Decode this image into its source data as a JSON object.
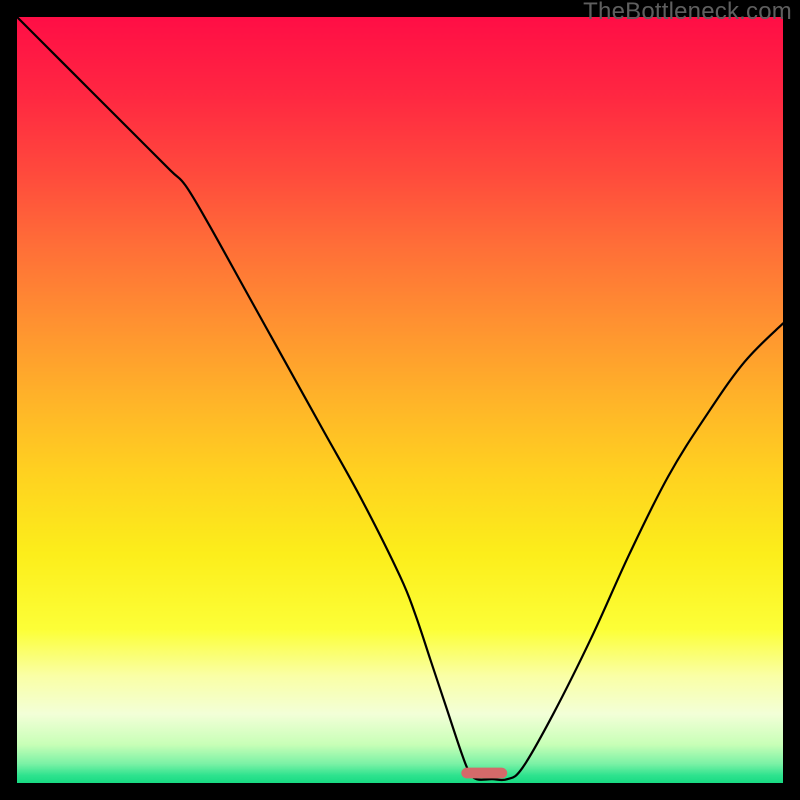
{
  "watermark": "TheBottleneck.com",
  "chart_data": {
    "type": "line",
    "title": "",
    "xlabel": "",
    "ylabel": "",
    "xlim": [
      0,
      100
    ],
    "ylim": [
      0,
      100
    ],
    "grid": false,
    "legend": false,
    "background_gradient": {
      "stops": [
        {
          "pos": 0.0,
          "color": "#ff0e46"
        },
        {
          "pos": 0.1,
          "color": "#ff2742"
        },
        {
          "pos": 0.2,
          "color": "#ff493d"
        },
        {
          "pos": 0.3,
          "color": "#ff6f38"
        },
        {
          "pos": 0.4,
          "color": "#ff9231"
        },
        {
          "pos": 0.5,
          "color": "#ffb429"
        },
        {
          "pos": 0.6,
          "color": "#ffd320"
        },
        {
          "pos": 0.7,
          "color": "#fcee1b"
        },
        {
          "pos": 0.8,
          "color": "#fcff38"
        },
        {
          "pos": 0.86,
          "color": "#faffa6"
        },
        {
          "pos": 0.91,
          "color": "#f3ffd8"
        },
        {
          "pos": 0.95,
          "color": "#c8ffb7"
        },
        {
          "pos": 0.975,
          "color": "#7bf2a6"
        },
        {
          "pos": 0.99,
          "color": "#2fe38f"
        },
        {
          "pos": 1.0,
          "color": "#18db82"
        }
      ]
    },
    "series": [
      {
        "name": "bottleneck-curve",
        "color": "#000000",
        "x": [
          0,
          5,
          10,
          15,
          20,
          22,
          25,
          30,
          35,
          40,
          45,
          50,
          52,
          54,
          56,
          58,
          59,
          60,
          62,
          64,
          66,
          70,
          75,
          80,
          85,
          90,
          95,
          100
        ],
        "y": [
          100,
          95,
          90,
          85,
          80,
          78,
          73,
          64,
          55,
          46,
          37,
          27,
          22,
          16,
          10,
          4,
          1.5,
          0.5,
          0.5,
          0.5,
          2,
          9,
          19,
          30,
          40,
          48,
          55,
          60
        ]
      }
    ],
    "marker": {
      "name": "optimal-range",
      "color": "#d46a6a",
      "x_center": 61,
      "width": 6,
      "y": 0.6,
      "height": 1.4
    }
  }
}
